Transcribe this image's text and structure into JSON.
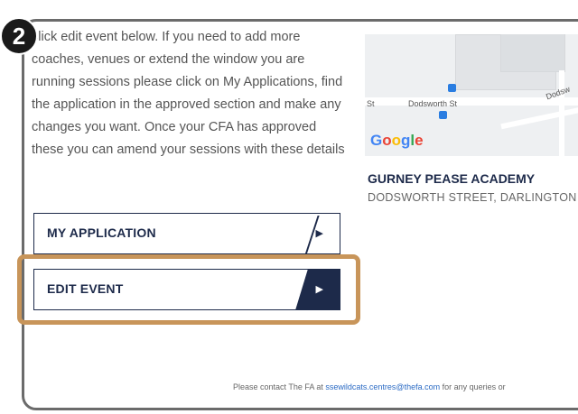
{
  "step_number": "2",
  "instructions": "click edit event below. If you need to add more coaches, venues or extend the window you are running sessions please click on My Applications, find the application in the approved section and make any changes you want. Once your CFA has approved these you can amend your sessions with these details",
  "buttons": {
    "my_application": "MY APPLICATION",
    "edit_event": "EDIT EVENT"
  },
  "map": {
    "street_label_1": "Dodsworth St",
    "street_label_left": "St",
    "street_label_right": "Dodsw",
    "google_logo": "Google"
  },
  "venue": {
    "name": "GURNEY PEASE ACADEMY",
    "address": "DODSWORTH STREET, DARLINGTON"
  },
  "footer": {
    "prefix": "Please contact The FA at ",
    "email": "ssewildcats.centres@thefa.com",
    "suffix": " for any queries or"
  },
  "colors": {
    "navy": "#1d2a4a",
    "highlight": "#c8955a"
  }
}
